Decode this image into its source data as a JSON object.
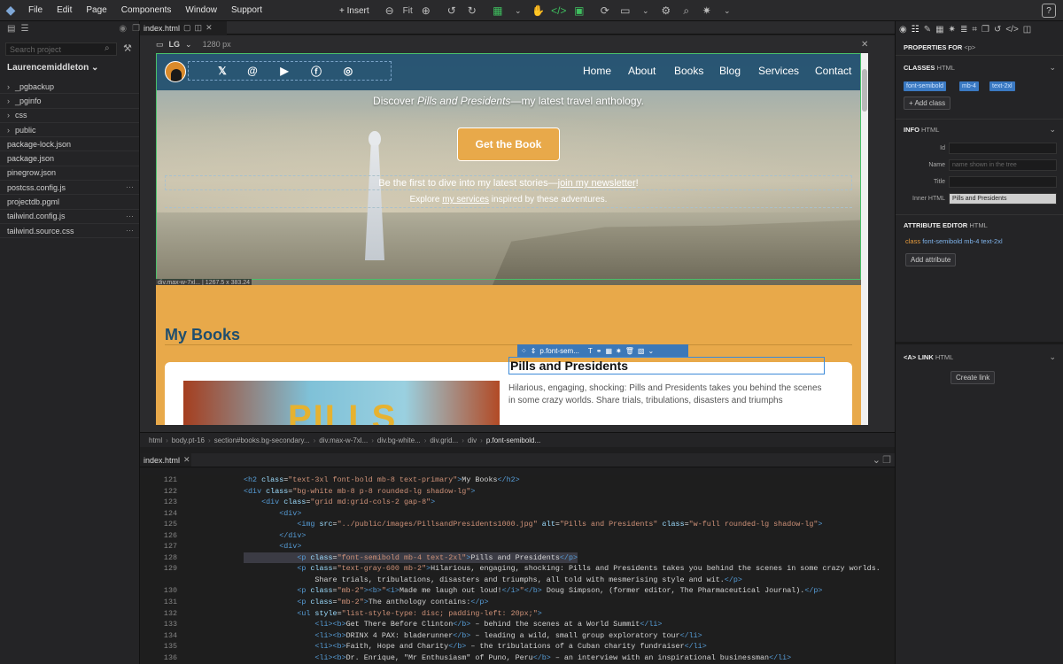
{
  "menubar": {
    "items": [
      "File",
      "Edit",
      "Page",
      "Components",
      "Window",
      "Support"
    ],
    "insert_label": "+ Insert",
    "fit_label": "Fit",
    "help_label": "?"
  },
  "left": {
    "search_placeholder": "Search project",
    "project_name": "Laurencemiddleton",
    "files": [
      {
        "name": "_pgbackup",
        "folder": true
      },
      {
        "name": "_pginfo",
        "folder": true
      },
      {
        "name": "css",
        "folder": true
      },
      {
        "name": "public",
        "folder": true
      },
      {
        "name": "package-lock.json",
        "folder": false
      },
      {
        "name": "package.json",
        "folder": false
      },
      {
        "name": "pinegrow.json",
        "folder": false
      },
      {
        "name": "postcss.config.js",
        "folder": false,
        "dots": true
      },
      {
        "name": "projectdb.pgml",
        "folder": false
      },
      {
        "name": "tailwind.config.js",
        "folder": false,
        "dots": true
      },
      {
        "name": "tailwind.source.css",
        "folder": false,
        "dots": true
      }
    ]
  },
  "editor": {
    "tab_name": "index.html",
    "device_label": "LG",
    "device_width": "1280 px"
  },
  "preview": {
    "nav_links": [
      "Home",
      "About",
      "Books",
      "Blog",
      "Services",
      "Contact"
    ],
    "social_icons": [
      "x-icon",
      "threads-icon",
      "youtube-icon",
      "facebook-icon",
      "instagram-icon"
    ],
    "hero_tag_pre": "Discover ",
    "hero_tag_em": "Pills and Presidents",
    "hero_tag_post": "—my latest travel anthology.",
    "cta_label": "Get the Book",
    "firstline_pre": "Be the first to dive into my latest stories—",
    "firstline_link": "join my newsletter",
    "firstline_post": "!",
    "explore_pre": "Explore ",
    "explore_link": "my services",
    "explore_post": " inspired by these adventures.",
    "hero_size": "div.max-w-7xl... | 1267.5 x 383.24",
    "section_title": "My Books",
    "book_img_text": "PILLS",
    "el_toolbar_label": "p.font-sem...",
    "book_title": "Pills and Presidents",
    "book_desc": "Hilarious, engaging, shocking: Pills and Presidents takes you behind the scenes in some crazy worlds. Share trials, tribulations, disasters and triumphs"
  },
  "breadcrumb": [
    "html",
    "body.pt-16",
    "section#books.bg-secondary...",
    "div.max-w-7xl...",
    "div.bg-white...",
    "div.grid...",
    "div",
    "p.font-semibold..."
  ],
  "code": {
    "tab_name": "index.html",
    "lines": [
      {
        "n": "121",
        "indent": "            ",
        "html": "<span class='tg'>&lt;h2</span> <span class='at'>class</span>=<span class='st'>\"text-3xl font-bold mb-8 text-primary\"</span><span class='tg'>&gt;</span>My Books<span class='tg'>&lt;/h2&gt;</span>"
      },
      {
        "n": "122",
        "indent": "            ",
        "html": "<span class='tg'>&lt;div</span> <span class='at'>class</span>=<span class='st'>\"bg-white mb-8 p-8 rounded-lg shadow-lg\"</span><span class='tg'>&gt;</span>"
      },
      {
        "n": "123",
        "indent": "                ",
        "html": "<span class='tg'>&lt;div</span> <span class='at'>class</span>=<span class='st'>\"grid md:grid-cols-2 gap-8\"</span><span class='tg'>&gt;</span>"
      },
      {
        "n": "124",
        "indent": "                    ",
        "html": "<span class='tg'>&lt;div&gt;</span>"
      },
      {
        "n": "125",
        "indent": "                        ",
        "html": "<span class='tg'>&lt;img</span> <span class='at'>src</span>=<span class='st'>\"../public/images/PillsandPresidents1000.jpg\"</span> <span class='at'>alt</span>=<span class='st'>\"Pills and Presidents\"</span> <span class='at'>class</span>=<span class='st'>\"w-full rounded-lg shadow-lg\"</span><span class='tg'>&gt;</span>"
      },
      {
        "n": "126",
        "indent": "                    ",
        "html": "<span class='tg'>&lt;/div&gt;</span>"
      },
      {
        "n": "127",
        "indent": "                    ",
        "html": "<span class='tg'>&lt;div&gt;</span>"
      },
      {
        "n": "128",
        "indent": "                        ",
        "html": "<span class='tg'>&lt;p</span> <span class='at'>class</span>=<span class='st'>\"font-semibold mb-4 text-2xl\"</span><span class='tg'>&gt;</span>Pills and Presidents<span class='tg'>&lt;/p&gt;</span>",
        "hl": true
      },
      {
        "n": "129",
        "indent": "                        ",
        "html": "<span class='tg'>&lt;p</span> <span class='at'>class</span>=<span class='st'>\"text-gray-600 mb-2\"</span><span class='tg'>&gt;</span>Hilarious, engaging, shocking: Pills and Presidents takes you behind the scenes in some crazy worlds."
      },
      {
        "n": "",
        "indent": "                            ",
        "html": "Share trials, tribulations, disasters and triumphs, all told with mesmerising style and wit.<span class='tg'>&lt;/p&gt;</span>"
      },
      {
        "n": "130",
        "indent": "                        ",
        "html": "<span class='tg'>&lt;p</span> <span class='at'>class</span>=<span class='st'>\"mb-2\"</span><span class='tg'>&gt;&lt;b&gt;</span><span class='st'>\"</span><span class='tg'>&lt;i&gt;</span>Made me laugh out loud!<span class='tg'>&lt;/i&gt;</span><span class='st'>\"</span><span class='tg'>&lt;/b&gt;</span> Doug Simpson, (former editor, The Pharmaceutical Journal).<span class='tg'>&lt;/p&gt;</span>"
      },
      {
        "n": "131",
        "indent": "                        ",
        "html": "<span class='tg'>&lt;p</span> <span class='at'>class</span>=<span class='st'>\"mb-2\"</span><span class='tg'>&gt;</span>The anthology contains:<span class='tg'>&lt;/p&gt;</span>"
      },
      {
        "n": "132",
        "indent": "                        ",
        "html": "<span class='tg'>&lt;ul</span> <span class='at'>style</span>=<span class='st'>\"list-style-type: disc; padding-left: 20px;\"</span><span class='tg'>&gt;</span>"
      },
      {
        "n": "133",
        "indent": "                            ",
        "html": "<span class='tg'>&lt;li&gt;&lt;b&gt;</span>Get There Before Clinton<span class='tg'>&lt;/b&gt;</span> – behind the scenes at a World Summit<span class='tg'>&lt;/li&gt;</span>"
      },
      {
        "n": "134",
        "indent": "                            ",
        "html": "<span class='tg'>&lt;li&gt;&lt;b&gt;</span>DRINX 4 PAX: bladerunner<span class='tg'>&lt;/b&gt;</span> – leading a wild, small group exploratory tour<span class='tg'>&lt;/li&gt;</span>"
      },
      {
        "n": "135",
        "indent": "                            ",
        "html": "<span class='tg'>&lt;li&gt;&lt;b&gt;</span>Faith, Hope and Charity<span class='tg'>&lt;/b&gt;</span> – the tribulations of a Cuban charity fundraiser<span class='tg'>&lt;/li&gt;</span>"
      },
      {
        "n": "136",
        "indent": "                            ",
        "html": "<span class='tg'>&lt;li&gt;&lt;b&gt;</span>Dr. Enrique, \"Mr Enthusiasm\" of Puno, Peru<span class='tg'>&lt;/b&gt;</span> – an interview with an inspirational businessman<span class='tg'>&lt;/li&gt;</span>"
      }
    ]
  },
  "right": {
    "properties_title": "PROPERTIES FOR",
    "properties_tag": "<p>",
    "classes_title": "CLASSES",
    "classes_sub": "HTML",
    "classes": [
      "font-semibold",
      "mb-4",
      "text-2xl"
    ],
    "add_class": "+ Add class",
    "info_title": "INFO",
    "info_sub": "HTML",
    "id_label": "Id",
    "name_label": "Name",
    "name_placeholder": "name shown in the tree",
    "title_label": "Title",
    "inner_label": "Inner HTML",
    "inner_value": "Pills and Presidents",
    "attr_title": "ATTRIBUTE EDITOR",
    "attr_sub": "HTML",
    "attr_name": "class",
    "attr_value": "font-semibold mb-4 text-2xl",
    "add_attr": "Add attribute",
    "link_title": "<A> LINK",
    "link_sub": "HTML",
    "create_link": "Create link"
  }
}
